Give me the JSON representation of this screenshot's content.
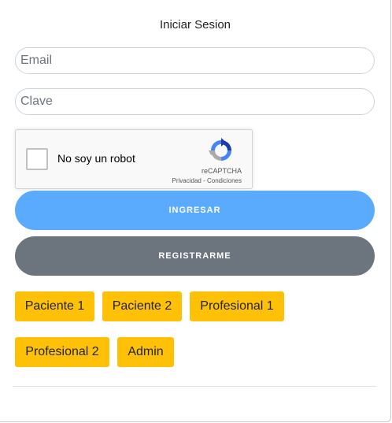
{
  "form": {
    "title": "Iniciar Sesion",
    "email_placeholder": "Email",
    "password_placeholder": "Clave"
  },
  "captcha": {
    "label": "No soy un robot",
    "brand": "reCAPTCHA",
    "links": "Privacidad - Condiciones"
  },
  "buttons": {
    "login": "INGRESAR",
    "register": "REGISTRARME"
  },
  "quick_access": [
    "Paciente 1",
    "Paciente 2",
    "Profesional 1",
    "Profesional 2",
    "Admin"
  ],
  "colors": {
    "primary": "#5aabfd",
    "secondary": "#6c757d",
    "warning": "#ffc107"
  }
}
